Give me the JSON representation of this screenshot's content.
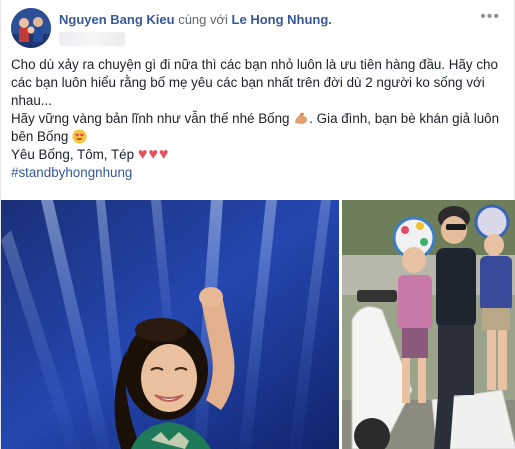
{
  "post": {
    "author": "Nguyen Bang Kieu",
    "with_text": "cùng với",
    "tagged": "Le Hong Nhung.",
    "menu_icon": "more-horizontal-icon",
    "text_line1": "Cho dù xảy ra chuyện gì đi nữa thì các bạn nhỏ luôn là ưu tiên hàng đầu. Hãy cho các bạn luôn hiểu rằng bố mẹ yêu các bạn nhất trên đời dù 2 người ko sống với nhau...",
    "text_line2a": "Hãy vững vàng bản lĩnh như vẫn thế nhé Bống",
    "text_line2b": ". Gia đình, bạn bè khán giả luôn bên Bống",
    "text_line3": "Yêu Bống, Tôm, Tép",
    "hearts": "♥♥♥",
    "hashtag": "#standbyhongnhung"
  },
  "colors": {
    "link": "#365899",
    "meta": "#616770",
    "heart": "#e8505b"
  }
}
